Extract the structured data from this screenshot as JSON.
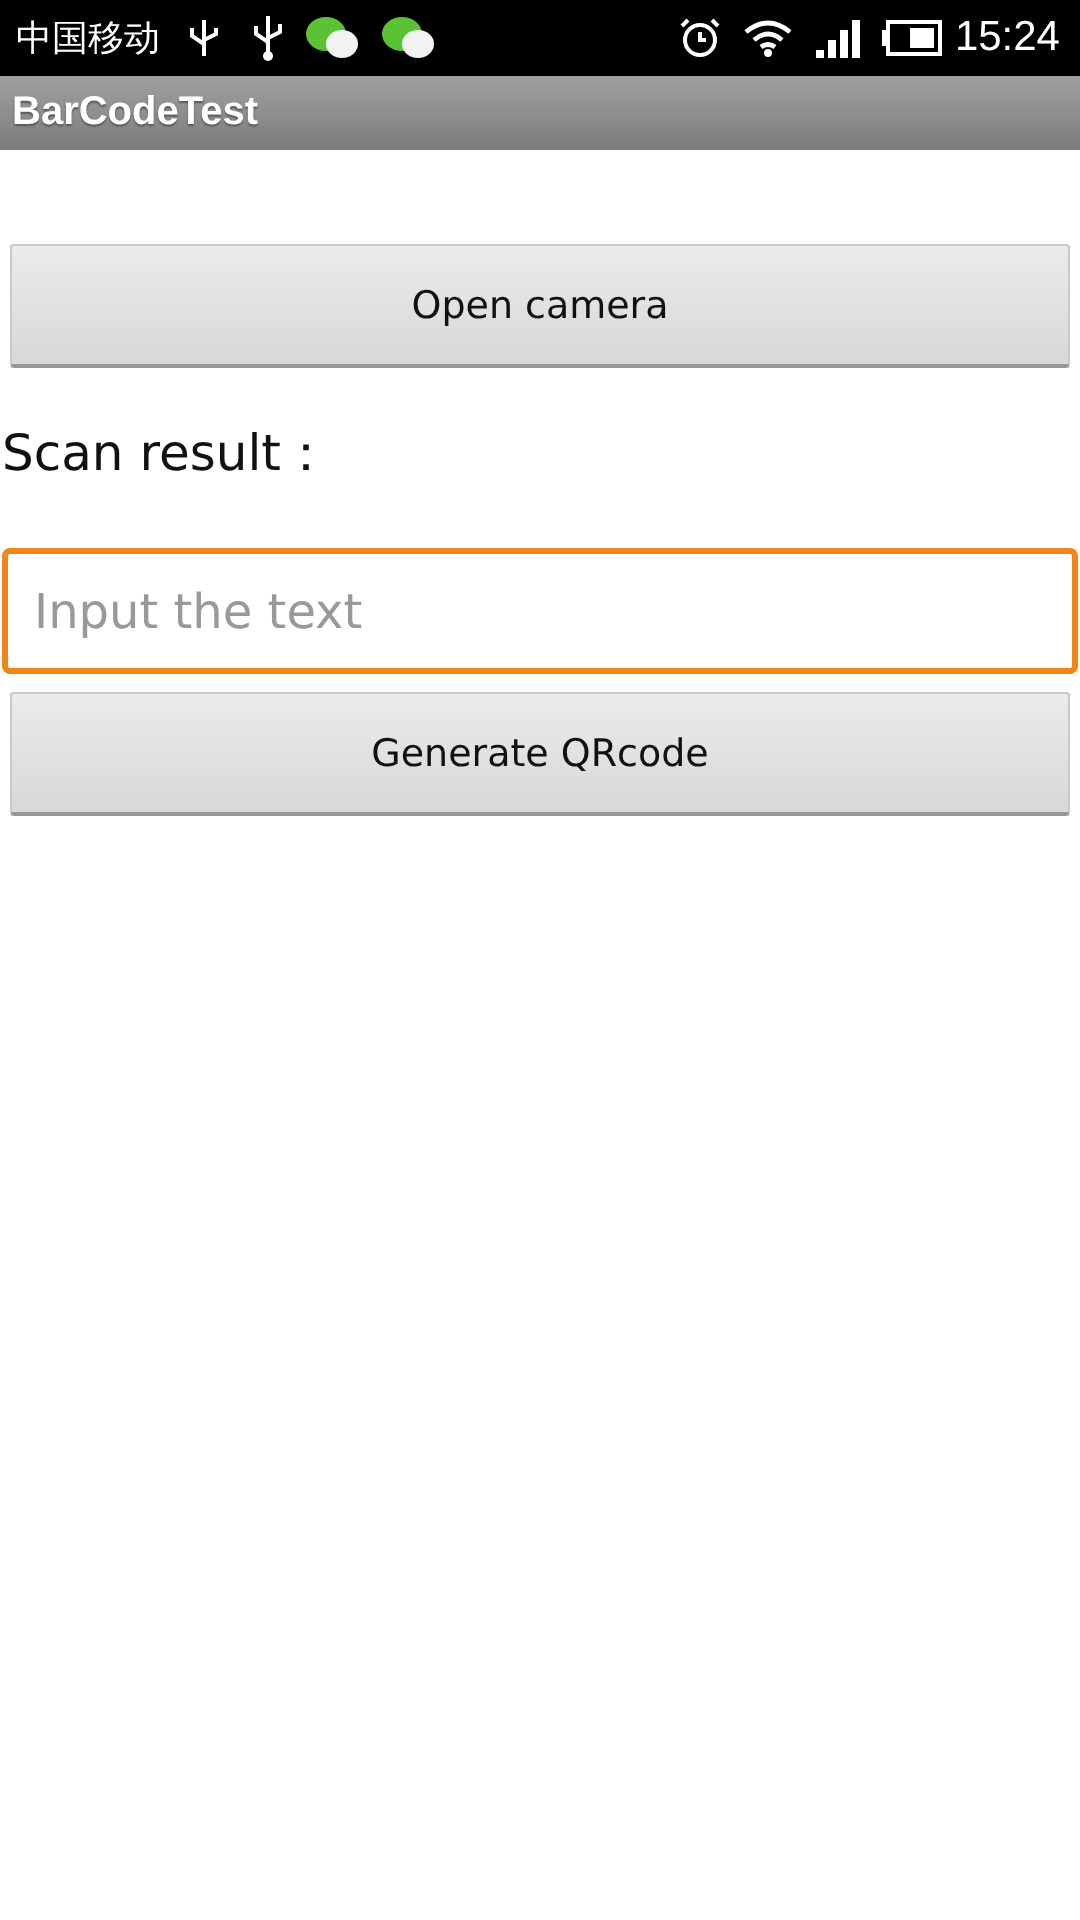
{
  "status_bar": {
    "carrier": "中国移动",
    "time": "15:24"
  },
  "title_bar": {
    "title": "BarCodeTest"
  },
  "open_button": {
    "label": "Open camera"
  },
  "scan_result": {
    "label": "Scan result："
  },
  "input": {
    "placeholder": "Input the text",
    "focused": true
  },
  "generate_button": {
    "label": "Generate QRcode"
  }
}
